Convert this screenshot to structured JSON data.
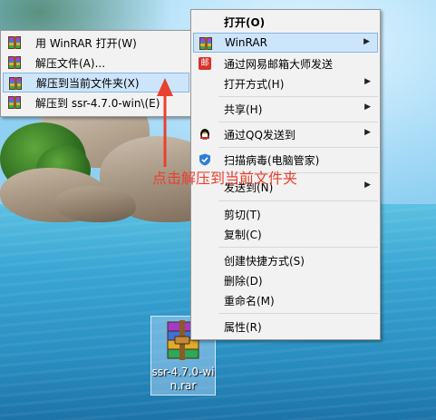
{
  "submenu": {
    "items": [
      {
        "label": "用 WinRAR 打开(W)",
        "icon": "winrar-icon"
      },
      {
        "label": "解压文件(A)...",
        "icon": "winrar-icon"
      },
      {
        "label": "解压到当前文件夹(X)",
        "icon": "winrar-icon",
        "highlighted": true
      },
      {
        "label": "解压到 ssr-4.7.0-win\\(E)",
        "icon": "winrar-icon"
      }
    ]
  },
  "context_menu": {
    "open": "打开(O)",
    "winrar": "WinRAR",
    "send_netease": "通过网易邮箱大师发送",
    "open_with": "打开方式(H)",
    "share": "共享(H)",
    "send_qq": "通过QQ发送到",
    "scan_virus": "扫描病毒(电脑管家)",
    "send_to": "发送到(N)",
    "cut": "剪切(T)",
    "copy": "复制(C)",
    "create_shortcut": "创建快捷方式(S)",
    "delete": "删除(D)",
    "rename": "重命名(M)",
    "properties": "属性(R)",
    "netease_icon_text": "邮"
  },
  "annotation": "点击解压到当前文件夹",
  "file": {
    "name": "ssr-4.7.0-win.rar"
  },
  "colors": {
    "highlight": "#cde5fb",
    "annotation": "#e8412f"
  }
}
